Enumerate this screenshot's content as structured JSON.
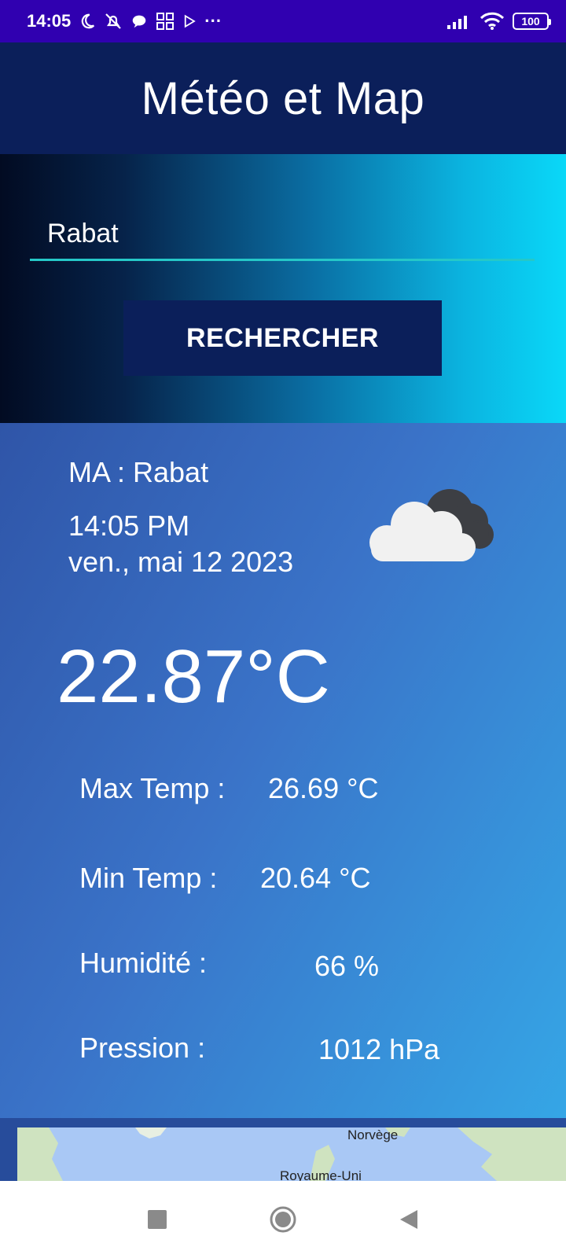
{
  "status_bar": {
    "time": "14:05",
    "more": "···",
    "battery": "100"
  },
  "app": {
    "title": "Météo et Map"
  },
  "search": {
    "value": "Rabat",
    "button_label": "RECHERCHER"
  },
  "weather": {
    "location": "MA  :  Rabat",
    "time": "14:05 PM",
    "date": "ven., mai 12 2023",
    "temperature": "22.87°C",
    "icon": "cloudy-icon",
    "details": {
      "max_label": "Max Temp :",
      "max_value": "26.69 °C",
      "min_label": "Min Temp :",
      "min_value": "20.64 °C",
      "humidity_label": "Humidité   :",
      "humidity_value": "66  %",
      "pressure_label": "Pression   :",
      "pressure_value": "1012  hPa"
    }
  },
  "map": {
    "labels": [
      "Norvège",
      "Royaume-Uni"
    ]
  },
  "colors": {
    "status_bar": "#3000b0",
    "app_bar": "#0b1f5a",
    "accent_underline": "#25c8c8",
    "card_start": "#2f55a8",
    "card_end": "#35a6e6"
  }
}
